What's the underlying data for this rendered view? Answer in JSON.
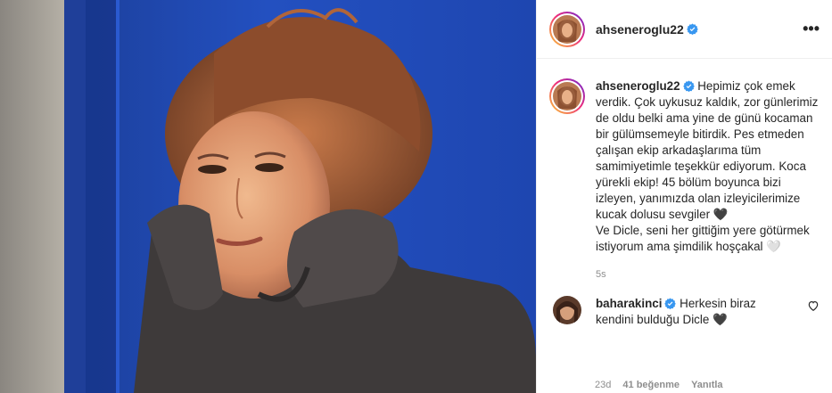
{
  "post": {
    "username": "ahseneroglu22",
    "more_icon": "•••"
  },
  "caption": {
    "username": "ahseneroglu22",
    "text": "Hepimiz çok emek verdik. Çok uykusuz kaldık, zor günlerimiz de oldu belki ama yine de günü kocaman bir gülümsemeyle bitirdik. Pes etmeden çalışan ekip arkadaşlarıma tüm samimiyetimle teşekkür ediyorum. Koca yürekli ekip! 45 bölüm boyunca bizi izleyen, yanımızda olan izleyicilerimize kucak dolusu sevgiler 🖤\nVe Dicle, seni her gittiğim yere götürmek istiyorum ama şimdilik hoşçakal 🤍",
    "time": "5s"
  },
  "comment": {
    "username": "baharakinci",
    "text": "Herkesin biraz kendini bulduğu Dicle 🖤",
    "age": "23d",
    "likes": "41 beğenme",
    "reply": "Yanıtla"
  },
  "colors": {
    "verified": "#3897f0",
    "muted": "#8e8e8e",
    "photo_bg": "#1c3f9e"
  },
  "icons": {
    "verified": "verified-badge-icon",
    "more": "more-options-icon",
    "heart": "heart-outline-icon"
  }
}
